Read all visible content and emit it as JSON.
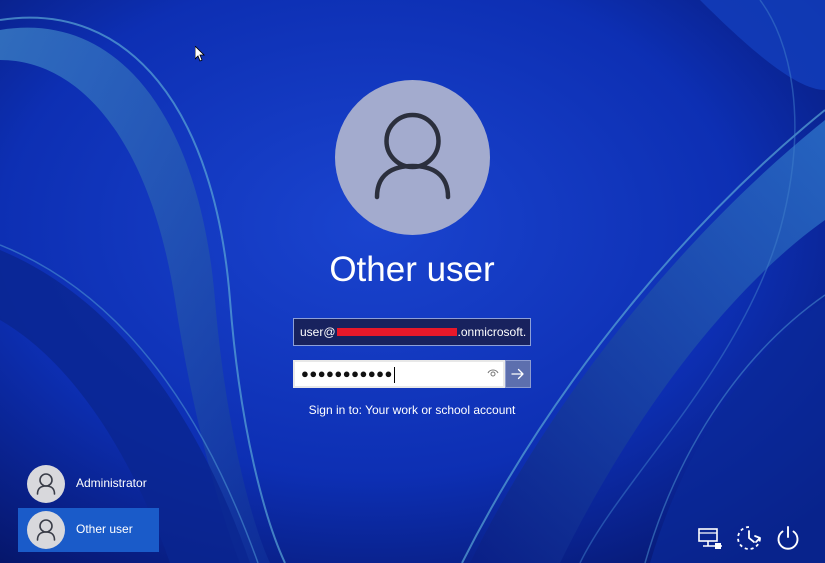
{
  "background": {
    "base_color": "#0b2a9e",
    "accent_color": "#4a8fd0"
  },
  "signin_panel": {
    "username": "Other user",
    "email_prefix": "user@",
    "email_suffix": ".onmicrosoft.",
    "email_redacted": true,
    "password_mask": "●●●●●●●●●●●",
    "sign_in_hint": "Sign in to: Your work or school account",
    "submit_icon": "arrow-right-icon",
    "reveal_icon": "eye-icon"
  },
  "user_list": [
    {
      "label": "Administrator",
      "selected": false
    },
    {
      "label": "Other user",
      "selected": true
    }
  ],
  "system_tray": {
    "icons": [
      "network-icon",
      "accessibility-icon",
      "power-icon"
    ]
  },
  "colors": {
    "selected_user": "#1a5bc9",
    "avatar": "#a3abce",
    "redaction": "#e8182a"
  }
}
